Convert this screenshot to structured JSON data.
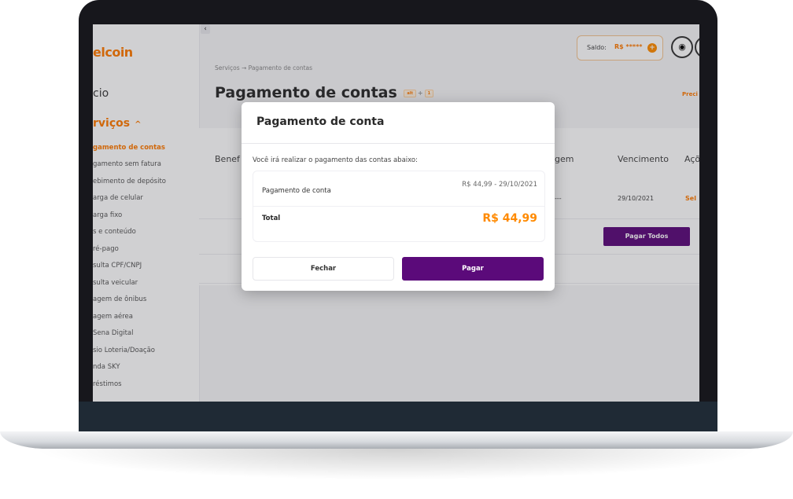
{
  "sidebar": {
    "logo": "elcoin",
    "inicio": "cio",
    "servicos": "rviços",
    "items": [
      "gamento de contas",
      "gamento sem fatura",
      "ebimento de depósito",
      "arga de celular",
      "arga fixo",
      "s e conteúdo",
      "ré-pago",
      "sulta CPF/CNPJ",
      "sulta veicular",
      "agem de ônibus",
      "agem aérea",
      "Sena Digital",
      "sio Loteria/Doação",
      "nda SKY",
      "réstimos"
    ]
  },
  "header": {
    "collapse_icon": "‹",
    "saldo_label": "Saldo:",
    "saldo_value": "R$ *****",
    "saldo_plus": "+",
    "breadcrumb": "Serviços → Pagamento de contas",
    "title": "Pagamento de contas",
    "shortcut_1": "alt",
    "shortcut_2": "1",
    "shortcut_plus": "+",
    "preci_link": "Preci"
  },
  "table": {
    "headers": [
      "Benef",
      "gem",
      "Vencimento",
      "Açõ"
    ],
    "row": {
      "col2": "---",
      "vencimento": "29/10/2021",
      "action": "Sel"
    },
    "pay_all": "Pagar Todos"
  },
  "modal": {
    "title": "Pagamento de conta",
    "description": "Você irá realizar o pagamento das contas abaixo:",
    "item_label": "Pagamento de conta",
    "item_value": "R$ 44,99 - 29/10/2021",
    "total_label": "Total",
    "total_value": "R$ 44,99",
    "close_button": "Fechar",
    "pay_button": "Pagar"
  }
}
